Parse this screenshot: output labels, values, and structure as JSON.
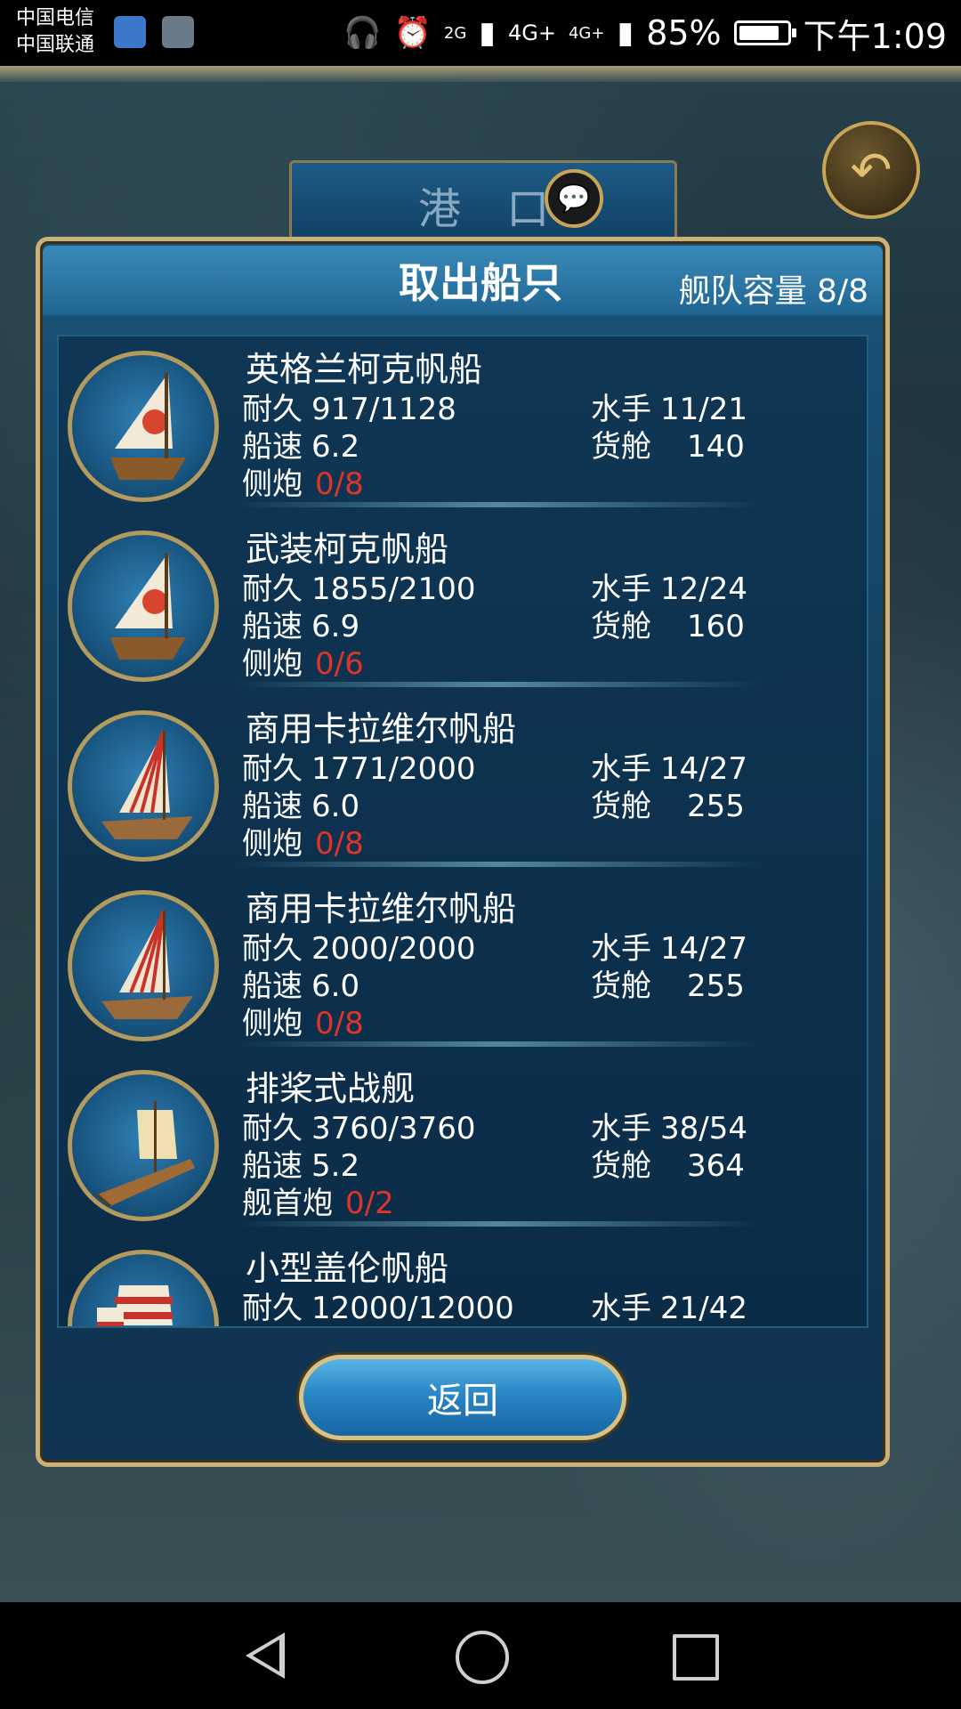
{
  "status_bar": {
    "carrier_1": "中国电信",
    "carrier_2": "中国联通",
    "network_2g": "2G",
    "network_4g": "4G+",
    "network_4g_2": "4G+",
    "battery": "85%",
    "battery_level": 0.85,
    "time": "下午1:09"
  },
  "background": {
    "port_title": "港 口"
  },
  "dialog": {
    "title": "取出船只",
    "capacity": "舰队容量 8/8",
    "return_label": "返回"
  },
  "ships": [
    {
      "name": "英格兰柯克帆船",
      "durability_label": "耐久",
      "durability": "917/1128",
      "speed_label": "船速",
      "speed": "6.2",
      "cannon_label": "侧炮",
      "cannon": "0/8",
      "crew_label": "水手",
      "crew": "11/21",
      "cargo_label": "货舱",
      "cargo": "140",
      "icon": "cog-sail-ship-icon"
    },
    {
      "name": "武装柯克帆船",
      "durability_label": "耐久",
      "durability": "1855/2100",
      "speed_label": "船速",
      "speed": "6.9",
      "cannon_label": "侧炮",
      "cannon": "0/6",
      "crew_label": "水手",
      "crew": "12/24",
      "cargo_label": "货舱",
      "cargo": "160",
      "icon": "cog-sail-ship-icon"
    },
    {
      "name": "商用卡拉维尔帆船",
      "durability_label": "耐久",
      "durability": "1771/2000",
      "speed_label": "船速",
      "speed": "6.0",
      "cannon_label": "侧炮",
      "cannon": "0/8",
      "crew_label": "水手",
      "crew": "14/27",
      "cargo_label": "货舱",
      "cargo": "255",
      "icon": "caravel-ship-icon"
    },
    {
      "name": "商用卡拉维尔帆船",
      "durability_label": "耐久",
      "durability": "2000/2000",
      "speed_label": "船速",
      "speed": "6.0",
      "cannon_label": "侧炮",
      "cannon": "0/8",
      "crew_label": "水手",
      "crew": "14/27",
      "cargo_label": "货舱",
      "cargo": "255",
      "icon": "caravel-ship-icon"
    },
    {
      "name": "排桨式战舰",
      "durability_label": "耐久",
      "durability": "3760/3760",
      "speed_label": "船速",
      "speed": "5.2",
      "cannon_label": "舰首炮",
      "cannon": "0/2",
      "crew_label": "水手",
      "crew": "38/54",
      "cargo_label": "货舱",
      "cargo": "364",
      "icon": "galley-ship-icon"
    },
    {
      "name": "小型盖伦帆船",
      "durability_label": "耐久",
      "durability": "12000/12000",
      "crew_label": "水手",
      "crew": "21/42",
      "icon": "galleon-ship-icon"
    }
  ]
}
